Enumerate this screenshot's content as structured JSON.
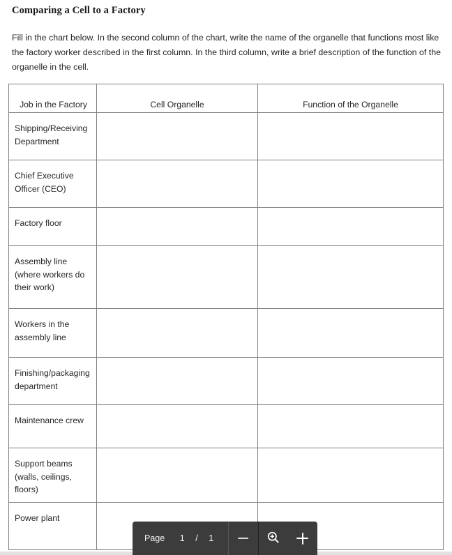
{
  "document": {
    "title": "Comparing a Cell to a Factory",
    "instructions": "Fill in the chart below. In the second column of the chart, write the name of the organelle that functions most like the factory worker described in the first column. In the third column, write a brief description of the function of the organelle in the cell."
  },
  "table": {
    "headers": [
      "Job in the Factory",
      "Cell Organelle",
      "Function of the Organelle"
    ],
    "rows": [
      {
        "job": "Shipping/Receiving Department",
        "organelle": "",
        "function": ""
      },
      {
        "job": "Chief Executive Officer (CEO)",
        "organelle": "",
        "function": ""
      },
      {
        "job": "Factory floor",
        "organelle": "",
        "function": ""
      },
      {
        "job": "Assembly line (where workers do their work)",
        "organelle": "",
        "function": ""
      },
      {
        "job": "Workers in the assembly line",
        "organelle": "",
        "function": ""
      },
      {
        "job": "Finishing/packaging department",
        "organelle": "",
        "function": ""
      },
      {
        "job": "Maintenance crew",
        "organelle": "",
        "function": ""
      },
      {
        "job": "Support beams (walls, ceilings, floors)",
        "organelle": "",
        "function": ""
      },
      {
        "job": "Power plant",
        "organelle": "",
        "function": ""
      }
    ]
  },
  "toolbar": {
    "page_label": "Page",
    "current_page": "1",
    "separator": "/",
    "total_pages": "1",
    "zoom_out_icon": "minus-icon",
    "zoom_icon": "magnifier-plus-icon",
    "zoom_in_icon": "plus-icon",
    "background_color": "#3c3c3c"
  }
}
